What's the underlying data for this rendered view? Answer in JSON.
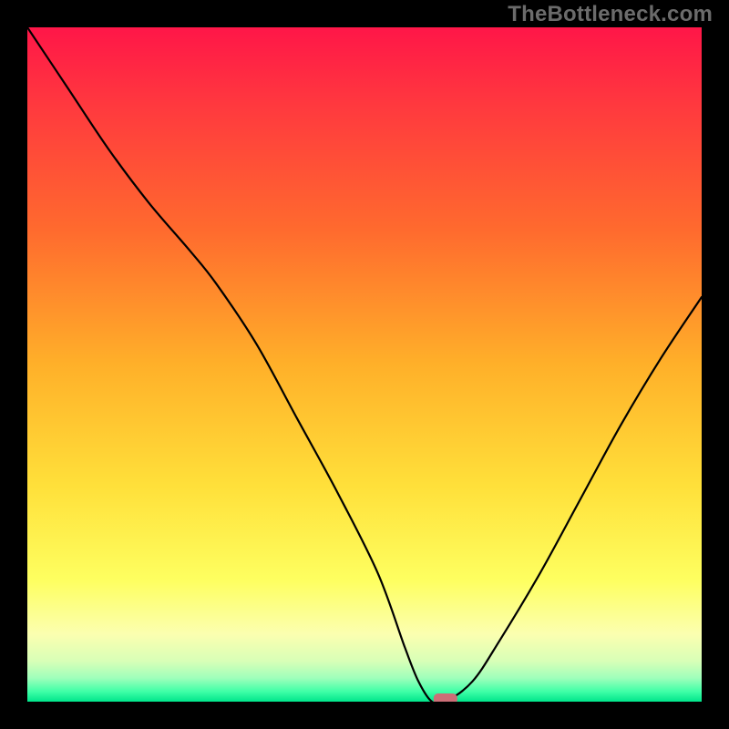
{
  "watermark": "TheBottleneck.com",
  "colors": {
    "gradient_stops": [
      {
        "offset": 0.0,
        "color": "#ff1648"
      },
      {
        "offset": 0.12,
        "color": "#ff3a3e"
      },
      {
        "offset": 0.3,
        "color": "#ff6a2e"
      },
      {
        "offset": 0.5,
        "color": "#ffb029"
      },
      {
        "offset": 0.68,
        "color": "#ffe03a"
      },
      {
        "offset": 0.82,
        "color": "#feff60"
      },
      {
        "offset": 0.9,
        "color": "#fbffb0"
      },
      {
        "offset": 0.94,
        "color": "#d8ffb7"
      },
      {
        "offset": 0.965,
        "color": "#9fffbb"
      },
      {
        "offset": 0.985,
        "color": "#3fffa7"
      },
      {
        "offset": 1.0,
        "color": "#00e58b"
      }
    ],
    "curve": "#000000",
    "marker": "#cc6e77",
    "frame": "#000000"
  },
  "chart_data": {
    "type": "line",
    "title": "",
    "xlabel": "",
    "ylabel": "",
    "xlim": [
      0,
      100
    ],
    "ylim": [
      0,
      100
    ],
    "x": [
      0,
      6,
      12,
      18,
      24,
      28,
      34,
      40,
      46,
      52,
      56,
      58,
      60,
      62,
      66,
      70,
      76,
      82,
      88,
      94,
      100
    ],
    "values": [
      100,
      91,
      82,
      74,
      67,
      62,
      53,
      42,
      31,
      19,
      8,
      3,
      0,
      0,
      3,
      9,
      19,
      30,
      41,
      51,
      60
    ],
    "marker": {
      "x": 62,
      "y": 0
    },
    "grid": false,
    "legend": false
  }
}
